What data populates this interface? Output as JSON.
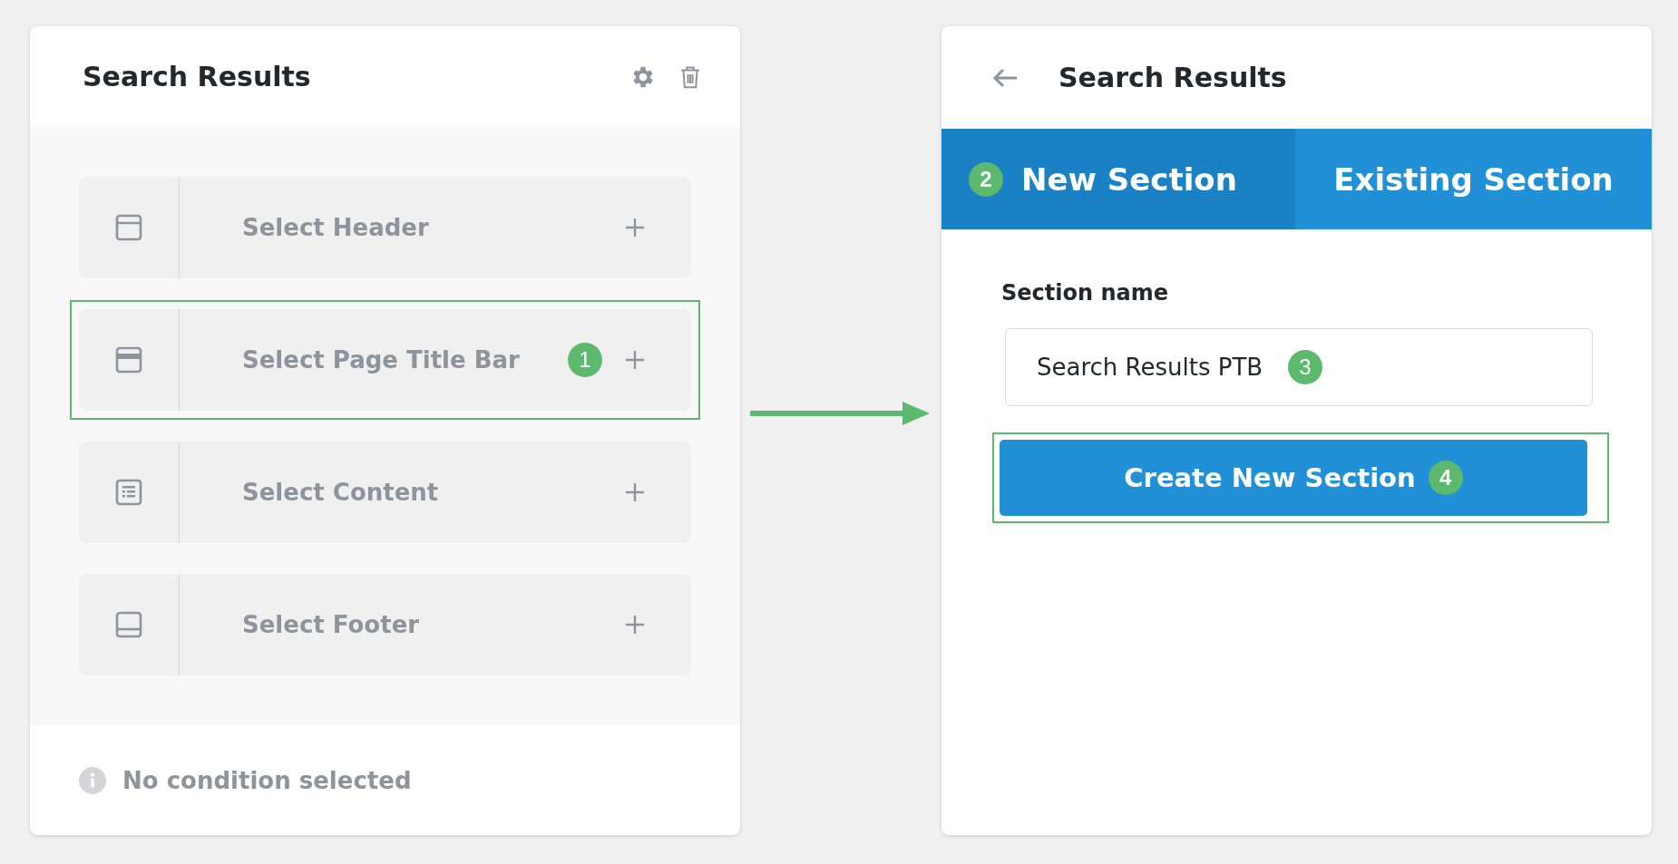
{
  "left_panel": {
    "title": "Search Results",
    "rows": [
      {
        "kind": "header",
        "label": "Select Header",
        "highlighted": false
      },
      {
        "kind": "title_bar",
        "label": "Select Page Title Bar",
        "highlighted": true,
        "callout": "1"
      },
      {
        "kind": "content",
        "label": "Select Content",
        "highlighted": false
      },
      {
        "kind": "footer",
        "label": "Select Footer",
        "highlighted": false
      }
    ],
    "footer_note": "No condition selected"
  },
  "right_panel": {
    "title": "Search Results",
    "tabs": [
      {
        "label": "New Section",
        "selected": true,
        "callout": "2"
      },
      {
        "label": "Existing Section",
        "selected": false
      }
    ],
    "field_label": "Section name",
    "field_value": "Search Results PTB",
    "field_callout": "3",
    "button": {
      "label": "Create New Section",
      "highlighted": true,
      "callout": "4"
    }
  }
}
